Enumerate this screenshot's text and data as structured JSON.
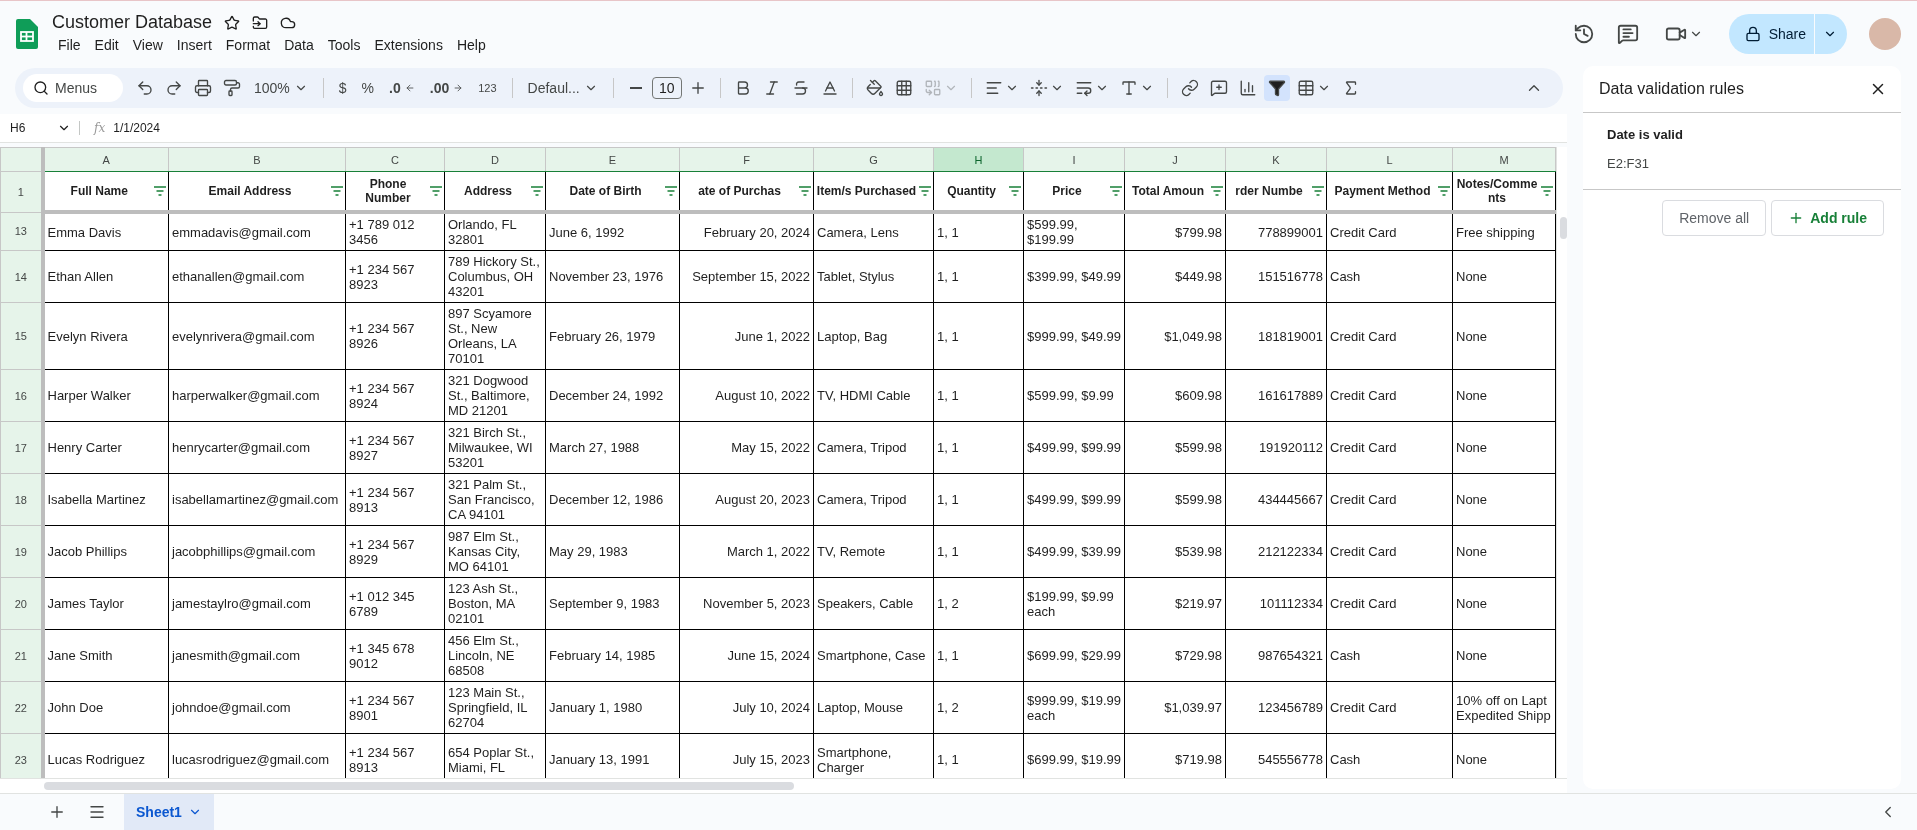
{
  "document": {
    "title": "Customer Database"
  },
  "menu": [
    "File",
    "Edit",
    "View",
    "Insert",
    "Format",
    "Data",
    "Tools",
    "Extensions",
    "Help"
  ],
  "share": {
    "label": "Share"
  },
  "toolbar": {
    "search_placeholder": "Menus",
    "zoom": "100%",
    "currency": "$",
    "percent": "%",
    "decrease_decimal": ".0",
    "increase_decimal": ".00",
    "more_formats": "123",
    "font": "Defaul...",
    "font_size": "10",
    "merge_disabled": true,
    "filter_active": true
  },
  "formula_bar": {
    "cell": "H6",
    "function_label": "fx",
    "value": "1/1/2024"
  },
  "column_letters": [
    {
      "label": "A",
      "selected": false
    },
    {
      "label": "B",
      "selected": false
    },
    {
      "label": "C",
      "selected": false
    },
    {
      "label": "D",
      "selected": false
    },
    {
      "label": "E",
      "selected": false
    },
    {
      "label": "F",
      "selected": false
    },
    {
      "label": "G",
      "selected": false
    },
    {
      "label": "H",
      "selected": true
    },
    {
      "label": "I",
      "selected": false
    },
    {
      "label": "J",
      "selected": false
    },
    {
      "label": "K",
      "selected": false
    },
    {
      "label": "L",
      "selected": false
    },
    {
      "label": "M",
      "selected": false
    }
  ],
  "header_row": {
    "number": "1",
    "columns": [
      "Full Name",
      "Email Address",
      "Phone Number",
      "Address",
      "Date of Birth",
      "ate of Purchas",
      "Item/s Purchased",
      "Quantity",
      "Price",
      "Total Amoun",
      "rder Numbe",
      "Payment Method",
      "Notes/Comments"
    ]
  },
  "rows": [
    {
      "number": "13",
      "cells": [
        "Emma Davis",
        "emmadavis@gmail.com",
        "+1 789 012 3456",
        "Orlando, FL 32801",
        "June 6, 1992",
        "February 20, 2024",
        "Camera, Lens",
        "1, 1",
        "$599.99, $199.99",
        "$799.98",
        "778899001",
        "Credit Card",
        "Free shipping"
      ]
    },
    {
      "number": "14",
      "cells": [
        "Ethan Allen",
        "ethanallen@gmail.com",
        "+1 234 567 8923",
        "789 Hickory St., Columbus, OH 43201",
        "November 23, 1976",
        "September 15, 2022",
        "Tablet, Stylus",
        "1, 1",
        "$399.99, $49.99",
        "$449.98",
        "151516778",
        "Cash",
        "None"
      ]
    },
    {
      "number": "15",
      "cells": [
        "Evelyn Rivera",
        "evelynrivera@gmail.com",
        "+1 234 567 8926",
        "897 Scyamore St., New Orleans, LA 70101",
        "February 26, 1979",
        "June 1, 2022",
        "Laptop, Bag",
        "1, 1",
        "$999.99, $49.99",
        "$1,049.98",
        "181819001",
        "Credit Card",
        "None"
      ]
    },
    {
      "number": "16",
      "cells": [
        "Harper Walker",
        "harperwalker@gmail.com",
        "+1 234 567 8924",
        "321 Dogwood St., Baltimore, MD 21201",
        "December 24, 1992",
        "August 10, 2022",
        "TV, HDMI Cable",
        "1, 1",
        "$599.99, $9.99",
        "$609.98",
        "161617889",
        "Credit Card",
        "None"
      ]
    },
    {
      "number": "17",
      "cells": [
        "Henry Carter",
        "henrycarter@gmail.com",
        "+1 234 567 8927",
        "321 Birch St., Milwaukee, WI 53201",
        "March 27, 1988",
        "May 15, 2022",
        "Camera, Tripod",
        "1, 1",
        "$499.99, $99.99",
        "$599.98",
        "191920112",
        "Credit Card",
        "None"
      ]
    },
    {
      "number": "18",
      "cells": [
        "Isabella Martinez",
        "isabellamartinez@gmail.com",
        "+1 234 567 8913",
        "321 Palm St., San Francisco, CA 94101",
        "December 12, 1986",
        "August 20, 2023",
        "Camera, Tripod",
        "1, 1",
        "$499.99, $99.99",
        "$599.98",
        "434445667",
        "Credit Card",
        "None"
      ]
    },
    {
      "number": "19",
      "cells": [
        "Jacob Phillips",
        "jacobphillips@gmail.com",
        "+1 234 567 8929",
        "987 Elm St., Kansas City, MO 64101",
        "May 29, 1983",
        "March 1, 2022",
        "TV, Remote",
        "1, 1",
        "$499.99, $39.99",
        "$539.98",
        "212122334",
        "Credit Card",
        "None"
      ]
    },
    {
      "number": "20",
      "cells": [
        "James Taylor",
        "jamestaylro@gmail.com",
        "+1 012 345 6789",
        "123 Ash St., Boston, MA 02101",
        "September 9, 1983",
        "November 5, 2023",
        "Speakers, Cable",
        "1, 2",
        "$199.99, $9.99 each",
        "$219.97",
        "101112334",
        "Credit Card",
        "None"
      ]
    },
    {
      "number": "21",
      "cells": [
        "Jane Smith",
        "janesmith@gmail.com",
        "+1 345 678 9012",
        "456 Elm St., Lincoln, NE 68508",
        "February 14, 1985",
        "June 15, 2024",
        "Smartphone, Case",
        "1, 1",
        "$699.99, $29.99",
        "$729.98",
        "987654321",
        "Cash",
        "None"
      ]
    },
    {
      "number": "22",
      "cells": [
        "John Doe",
        "johndoe@gmail.com",
        "+1 234 567 8901",
        "123 Main St., Springfield, IL 62704",
        "January 1, 1980",
        "July 10, 2024",
        "Laptop, Mouse",
        "1, 2",
        "$999.99, $19.99 each",
        "$1,039.97",
        "123456789",
        "Credit Card",
        "10% off on Lapt Expedited Shipp"
      ]
    },
    {
      "number": "23",
      "cells": [
        "Lucas Rodriguez",
        "lucasrodriguez@gmail.com",
        "+1 234 567 8913",
        "654 Poplar St., Miami, FL",
        "January 13, 1991",
        "July 15, 2023",
        "Smartphone, Charger",
        "1, 1",
        "$699.99, $19.99",
        "$719.98",
        "545556778",
        "Cash",
        "None"
      ]
    }
  ],
  "side_panel": {
    "title": "Data validation rules",
    "rule": {
      "title": "Date is valid",
      "range": "E2:F31"
    },
    "buttons": [
      {
        "label": "Remove all",
        "kind": "secondary"
      },
      {
        "label": "Add rule",
        "kind": "add"
      }
    ]
  },
  "sheets": [
    {
      "label": "Sheet1",
      "selected": true
    }
  ]
}
